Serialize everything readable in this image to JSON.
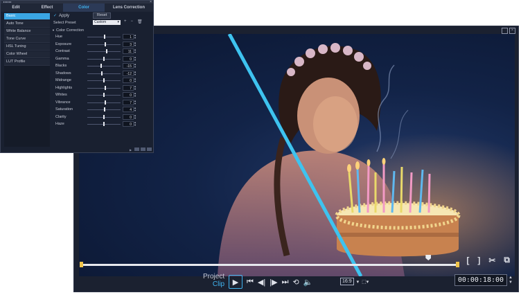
{
  "panel": {
    "tabs": [
      "Edit",
      "Effect",
      "Color",
      "Lens Correction"
    ],
    "active_tab": 2,
    "sidebar": [
      "Basic",
      "Auto Tone",
      "White Balance",
      "Tone Curve",
      "HSL Tuning",
      "Color Wheel",
      "LUT Profile"
    ],
    "active_item": 0,
    "apply_label": "Apply",
    "reset_label": "Reset",
    "preset_label": "Select Preset",
    "preset_value": "Custom",
    "section_label": "Color Correction",
    "sliders": [
      {
        "label": "Hue",
        "value": "1",
        "pos": 0.52
      },
      {
        "label": "Exposure",
        "value": "3",
        "pos": 0.54
      },
      {
        "label": "Contrast",
        "value": "11",
        "pos": 0.58
      },
      {
        "label": "Gamma",
        "value": "0",
        "pos": 0.5
      },
      {
        "label": "Blacks",
        "value": "-15",
        "pos": 0.42
      },
      {
        "label": "Shadows",
        "value": "-12",
        "pos": 0.44
      },
      {
        "label": "Midrange",
        "value": "0",
        "pos": 0.5
      },
      {
        "label": "Highlights",
        "value": "7",
        "pos": 0.54
      },
      {
        "label": "Whites",
        "value": "0",
        "pos": 0.5
      },
      {
        "label": "Vibrance",
        "value": "7",
        "pos": 0.54
      },
      {
        "label": "Saturation",
        "value": "4",
        "pos": 0.52
      },
      {
        "label": "Clarity",
        "value": "0",
        "pos": 0.5
      },
      {
        "label": "Haze",
        "value": "0",
        "pos": 0.5
      }
    ]
  },
  "player": {
    "project_label": "Project",
    "clip_label": "Clip",
    "aspect_ratio": "16:9",
    "timecode": "00:00:18:00",
    "playhead_position": 0.92,
    "accent_color": "#40b4f0",
    "marker_color": "#f0c44a"
  },
  "icons": {
    "transport": [
      "play-icon",
      "skip-start-icon",
      "prev-frame-icon",
      "next-frame-icon",
      "skip-end-icon",
      "repeat-icon",
      "volume-icon"
    ],
    "edit": [
      "mark-in-icon",
      "mark-out-icon",
      "split-icon",
      "snapshot-icon"
    ]
  }
}
